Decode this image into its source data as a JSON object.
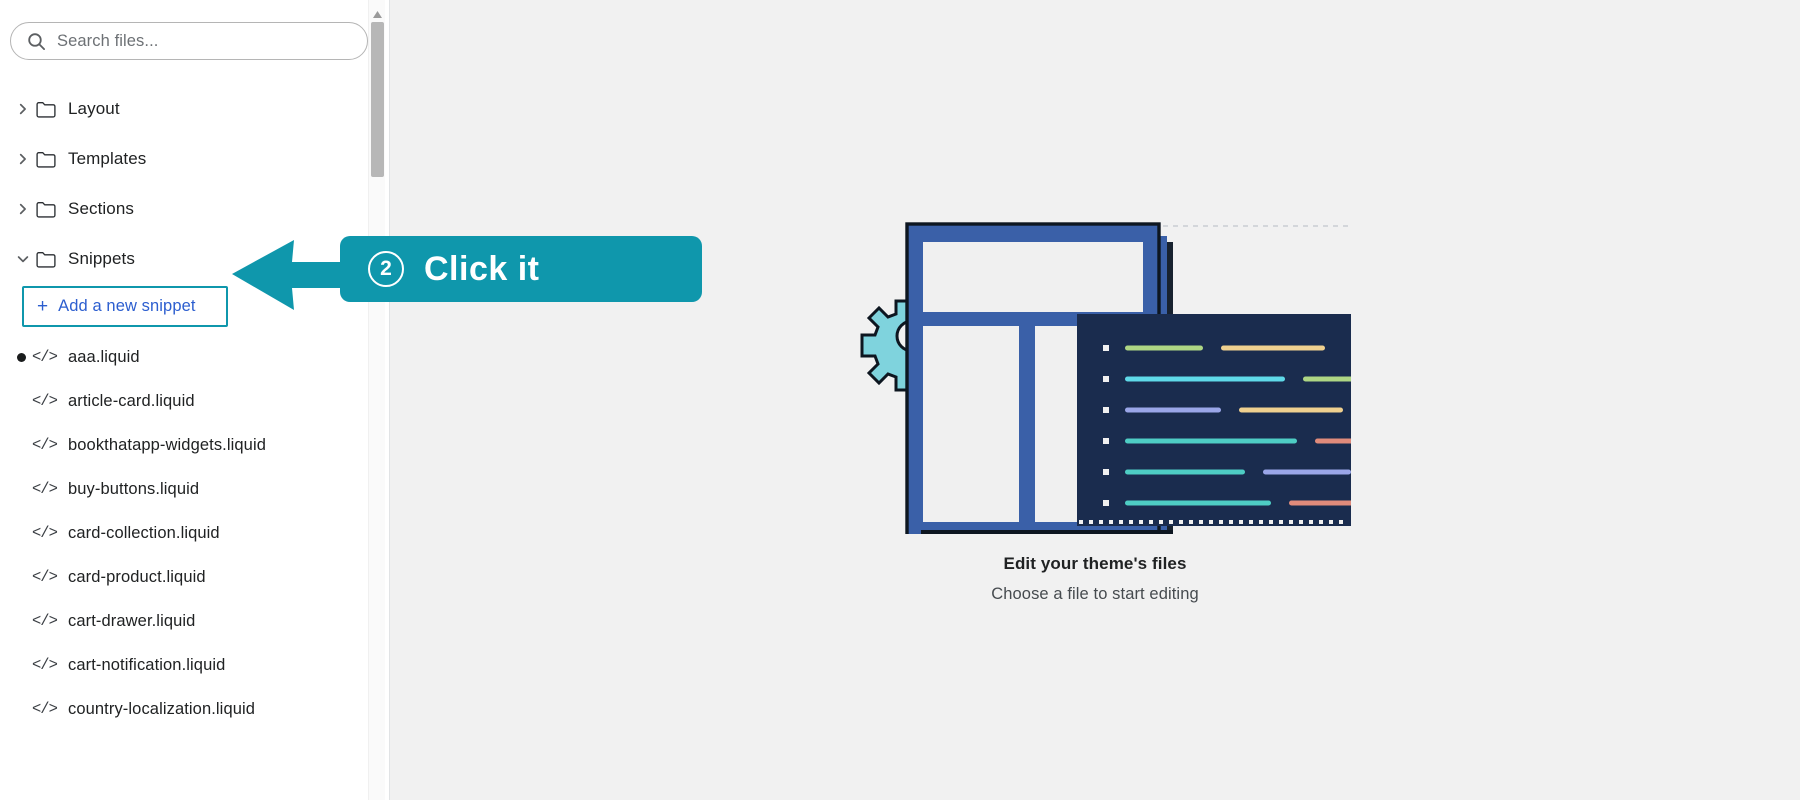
{
  "search": {
    "placeholder": "Search files...",
    "icon": "search-icon"
  },
  "sidebar": {
    "folders": [
      {
        "label": "Layout",
        "expanded": false,
        "caret": "chevron-right-icon"
      },
      {
        "label": "Templates",
        "expanded": false,
        "caret": "chevron-right-icon"
      },
      {
        "label": "Sections",
        "expanded": false,
        "caret": "chevron-right-icon"
      },
      {
        "label": "Snippets",
        "expanded": true,
        "caret": "chevron-down-icon"
      }
    ],
    "add_snippet": {
      "plus": "+",
      "label": "Add a new snippet"
    },
    "files": [
      {
        "name": "aaa.liquid",
        "modified": true
      },
      {
        "name": "article-card.liquid",
        "modified": false
      },
      {
        "name": "bookthatapp-widgets.liquid",
        "modified": false
      },
      {
        "name": "buy-buttons.liquid",
        "modified": false
      },
      {
        "name": "card-collection.liquid",
        "modified": false
      },
      {
        "name": "card-product.liquid",
        "modified": false
      },
      {
        "name": "cart-drawer.liquid",
        "modified": false
      },
      {
        "name": "cart-notification.liquid",
        "modified": false
      },
      {
        "name": "country-localization.liquid",
        "modified": false
      }
    ],
    "code_icon_glyph": "</>"
  },
  "main": {
    "empty_state": {
      "title": "Edit your theme's files",
      "subtitle": "Choose a file to start editing"
    },
    "illustration": {
      "name": "theme-files-illustration",
      "gear_color": "#7fd3dd",
      "window_color": "#3a60a8",
      "code_panel_color": "#1a2c4e",
      "code_lines": [
        {
          "left_color": "#aed684",
          "left_width": 78,
          "right_color": "#efd08f",
          "right_width": 104
        },
        {
          "left_color": "#5fd9e8",
          "left_width": 160,
          "right_color": "#aed684",
          "right_width": 100
        },
        {
          "left_color": "#9aa6e8",
          "left_width": 96,
          "right_color": "#efd08f",
          "right_width": 104
        },
        {
          "left_color": "#4ecdc4",
          "left_width": 172,
          "right_color": "#e08b7b",
          "right_width": 90
        },
        {
          "left_color": "#4ecdc4",
          "left_width": 120,
          "right_color": "#9aa6e8",
          "right_width": 88
        },
        {
          "left_color": "#4ecdc4",
          "left_width": 146,
          "right_color": "#e08b7b",
          "right_width": 80
        }
      ]
    }
  },
  "callout": {
    "step_number": "2",
    "text": "Click it",
    "color": "#0f97ac"
  },
  "colors": {
    "accent_teal": "#0f97ac",
    "link_blue": "#2c5ecf",
    "main_bg": "#f1f1f1"
  }
}
